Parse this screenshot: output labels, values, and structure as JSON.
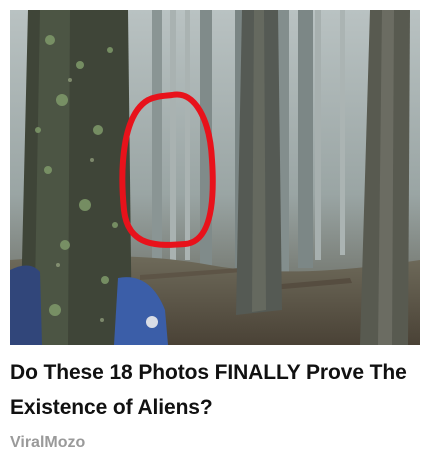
{
  "ad": {
    "headline": "Do These 18 Photos FINALLY Prove The Existence of Aliens?",
    "source": "ViralMozo",
    "image": {
      "subject": "foggy-forest-photo",
      "highlight_color": "#e8121b"
    }
  }
}
